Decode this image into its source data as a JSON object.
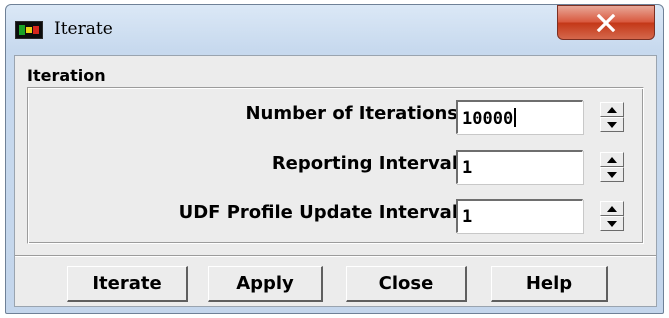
{
  "window": {
    "title": "Iterate",
    "icon": "fluent-app-icon",
    "close_icon": "close-icon"
  },
  "group": {
    "label": "Iteration"
  },
  "fields": [
    {
      "label": "Number of Iterations",
      "value": "10000"
    },
    {
      "label": "Reporting Interval",
      "value": "1"
    },
    {
      "label": "UDF Profile Update Interval",
      "value": "1"
    }
  ],
  "spinner_icons": {
    "up": "arrow-up-icon",
    "down": "arrow-down-icon"
  },
  "buttons": {
    "iterate": "Iterate",
    "apply": "Apply",
    "close": "Close",
    "help": "Help"
  },
  "colors": {
    "close_button": "#c43818",
    "titlebar": "#c7d9ee",
    "dialog_bg": "#ececec"
  }
}
